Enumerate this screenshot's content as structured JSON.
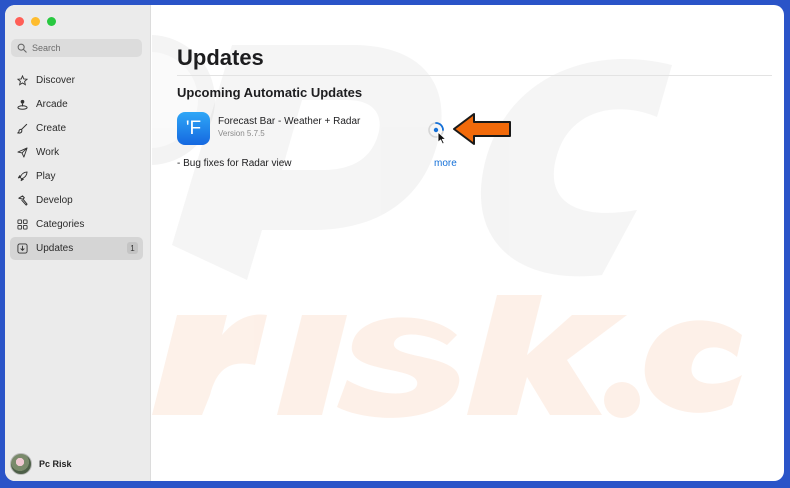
{
  "sidebar": {
    "search_placeholder": "Search",
    "items": [
      {
        "label": "Discover",
        "icon": "star-icon"
      },
      {
        "label": "Arcade",
        "icon": "joystick-icon"
      },
      {
        "label": "Create",
        "icon": "brush-icon"
      },
      {
        "label": "Work",
        "icon": "paper-plane-icon"
      },
      {
        "label": "Play",
        "icon": "rocket-icon"
      },
      {
        "label": "Develop",
        "icon": "hammer-icon"
      },
      {
        "label": "Categories",
        "icon": "grid-icon"
      },
      {
        "label": "Updates",
        "icon": "download-icon",
        "badge": "1",
        "selected": true
      }
    ],
    "profile_name": "Pc Risk"
  },
  "main": {
    "title": "Updates",
    "section_title": "Upcoming Automatic Updates",
    "app": {
      "icon_letter": "'F",
      "name": "Forecast Bar - Weather + Radar",
      "version": "Version 5.7.5",
      "notes": "- Bug fixes for Radar view",
      "more_label": "more",
      "status": "updating-spinner"
    }
  },
  "colors": {
    "accent": "#1470d8",
    "annotation_arrow": "#f26a0a",
    "desktop_background": "#2a54c8"
  }
}
